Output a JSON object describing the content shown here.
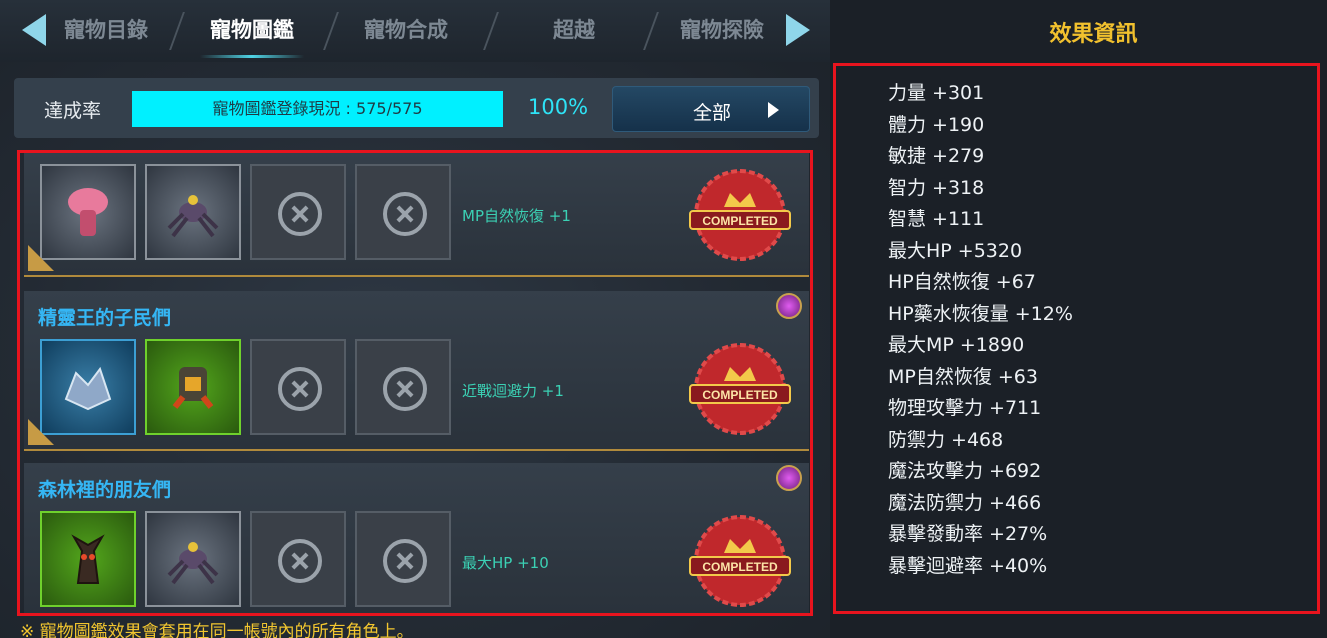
{
  "tabs": [
    {
      "label": "寵物目錄",
      "active": false
    },
    {
      "label": "寵物圖鑑",
      "active": true
    },
    {
      "label": "寵物合成",
      "active": false
    },
    {
      "label": "超越",
      "active": false
    },
    {
      "label": "寵物探險",
      "active": false
    }
  ],
  "achievement": {
    "label": "達成率",
    "progress_text": "寵物圖鑑登錄現況 : 575/575",
    "progress_fraction": 1.0,
    "percent": "100%",
    "filter_button": "全部"
  },
  "collections": [
    {
      "title": "",
      "effect": "MP自然恢復 +1",
      "status": "COMPLETED",
      "slots": [
        "pink-jellyfish-pet",
        "spider-pet",
        "empty",
        "empty"
      ]
    },
    {
      "title": "精靈王的子民們",
      "effect": "近戰迴避力 +1",
      "status": "COMPLETED",
      "slots": [
        "crystal-beast-pet",
        "armored-golem-pet",
        "empty",
        "empty"
      ]
    },
    {
      "title": "森林裡的朋友們",
      "effect": "最大HP +10",
      "status": "COMPLETED",
      "slots": [
        "treant-pet",
        "spider-pet",
        "empty",
        "empty"
      ]
    }
  ],
  "footnote": "※ 寵物圖鑑效果會套用在同一帳號內的所有角色上。",
  "effects_panel": {
    "title": "效果資訊",
    "stats": [
      "力量 +301",
      "體力 +190",
      "敏捷 +279",
      "智力 +318",
      "智慧 +111",
      "最大HP +5320",
      "HP自然恢復 +67",
      "HP藥水恢復量 +12%",
      "最大MP +1890",
      "MP自然恢復 +63",
      "物理攻擊力 +711",
      "防禦力 +468",
      "魔法攻擊力 +692",
      "魔法防禦力 +466",
      "暴擊發動率 +27%",
      "暴擊迴避率 +40%"
    ]
  },
  "colors": {
    "progress": "#00f0ff",
    "highlight_border": "#e8141e",
    "effect_text": "#3bd1b4",
    "title_gold": "#f2c12e"
  }
}
